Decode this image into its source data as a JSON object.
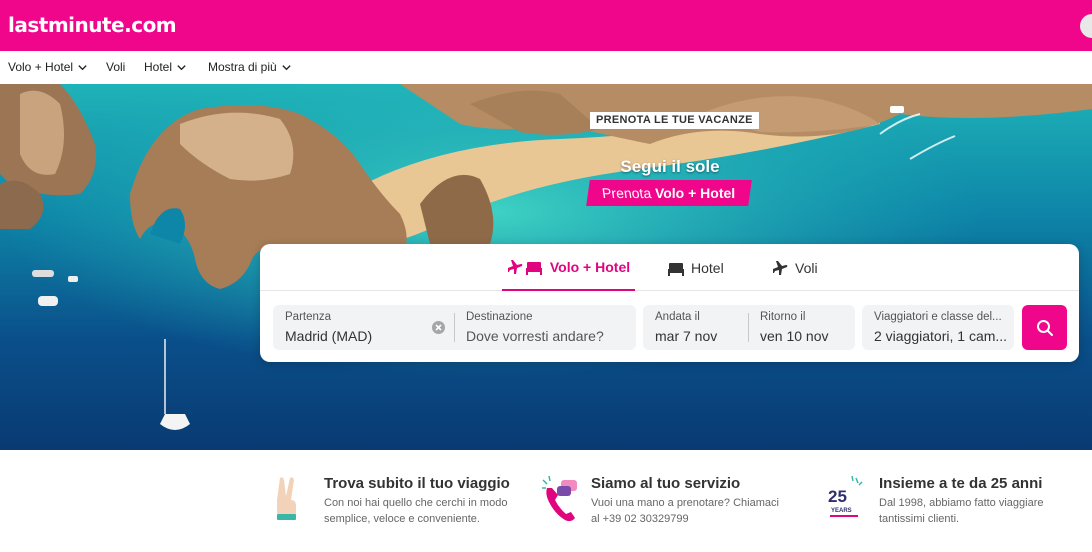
{
  "brand": {
    "logo_text": "lastminute.com",
    "primary_color": "#f0068a"
  },
  "nav": {
    "items": [
      {
        "label": "Volo + Hotel",
        "dropdown": true
      },
      {
        "label": "Voli",
        "dropdown": false
      },
      {
        "label": "Hotel",
        "dropdown": true
      },
      {
        "label": "Mostra di più",
        "dropdown": true
      }
    ]
  },
  "hero": {
    "badge": "PRENOTA LE TUE VACANZE",
    "title": "Segui il sole",
    "cta_prefix": "Prenota ",
    "cta_bold": "Volo + Hotel"
  },
  "search": {
    "tabs": [
      {
        "label": "Volo + Hotel",
        "icon": "plane-bed-icon",
        "active": true
      },
      {
        "label": "Hotel",
        "icon": "bed-icon",
        "active": false
      },
      {
        "label": "Voli",
        "icon": "plane-icon",
        "active": false
      }
    ],
    "departure": {
      "label": "Partenza",
      "value": "Madrid (MAD)"
    },
    "destination": {
      "label": "Destinazione",
      "placeholder": "Dove vorresti andare?"
    },
    "outbound": {
      "label": "Andata il",
      "value": "mar 7 nov"
    },
    "return": {
      "label": "Ritorno il",
      "value": "ven 10 nov"
    },
    "travellers": {
      "label": "Viaggiatori e classe del...",
      "value": "2 viaggiatori, 1 cam..."
    }
  },
  "features": [
    {
      "icon": "victory-hand-icon",
      "title": "Trova subito il tuo viaggio",
      "line1": "Con noi hai quello che cerchi in modo",
      "line2": "semplice, veloce e conveniente."
    },
    {
      "icon": "phone-chat-icon",
      "title": "Siamo al tuo servizio",
      "line1": "Vuoi una mano a prenotare? Chiamaci",
      "line2": "al +39 02 30329799"
    },
    {
      "icon": "anniversary-25-icon",
      "title": "Insieme a te da 25 anni",
      "line1": "Dal 1998, abbiamo fatto viaggiare",
      "line2": "tantissimi clienti.",
      "badge_number": "25",
      "badge_word": "YEARS"
    }
  ]
}
